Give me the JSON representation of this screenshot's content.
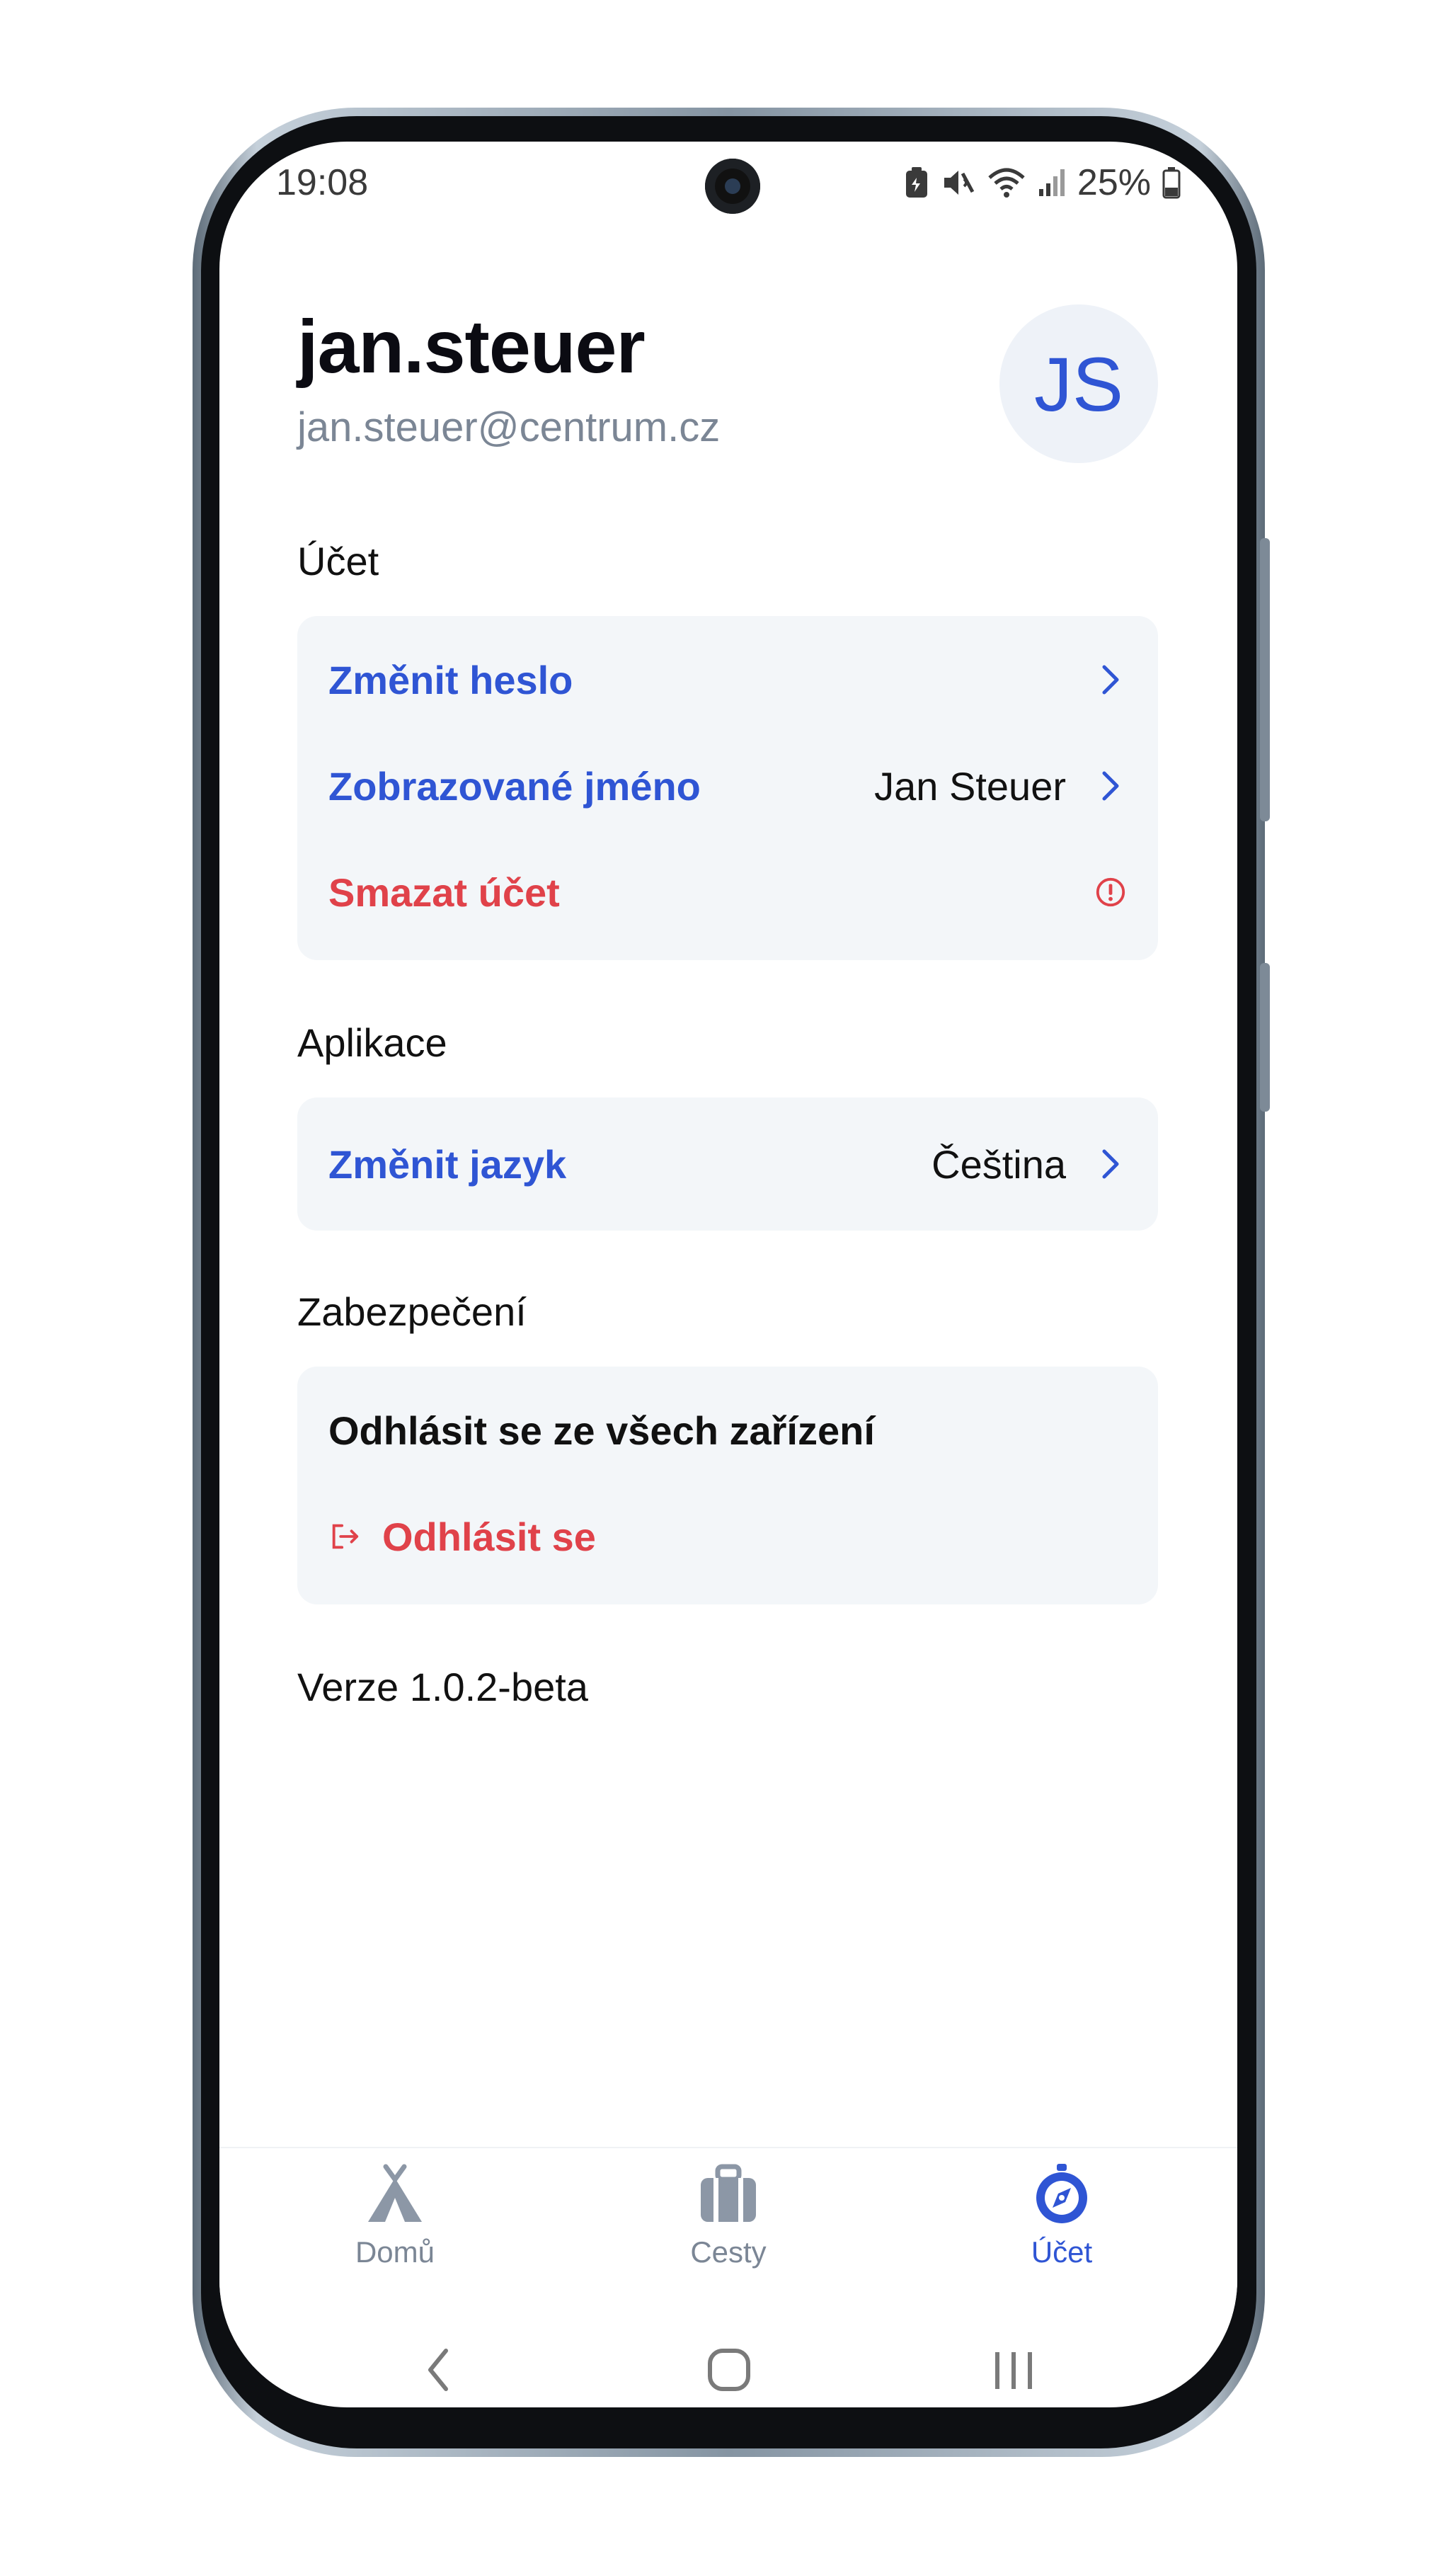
{
  "status_bar": {
    "time": "19:08",
    "battery": "25%"
  },
  "profile": {
    "username": "jan.steuer",
    "email": "jan.steuer@centrum.cz",
    "initials": "JS"
  },
  "sections": {
    "account": {
      "title": "Účet",
      "change_password": "Změnit heslo",
      "display_name_label": "Zobrazované jméno",
      "display_name_value": "Jan Steuer",
      "delete_account": "Smazat účet"
    },
    "application": {
      "title": "Aplikace",
      "change_language": "Změnit jazyk",
      "language_value": "Čeština"
    },
    "security": {
      "title": "Zabezpečení",
      "logout_all": "Odhlásit se ze všech zařízení",
      "logout": "Odhlásit se"
    }
  },
  "version": "Verze 1.0.2-beta",
  "bottom_nav": {
    "home": "Domů",
    "trips": "Cesty",
    "account": "Účet"
  },
  "colors": {
    "accent": "#2f55d4",
    "danger": "#e0424a",
    "card_bg": "#f3f6f9",
    "muted": "#7b8695"
  }
}
